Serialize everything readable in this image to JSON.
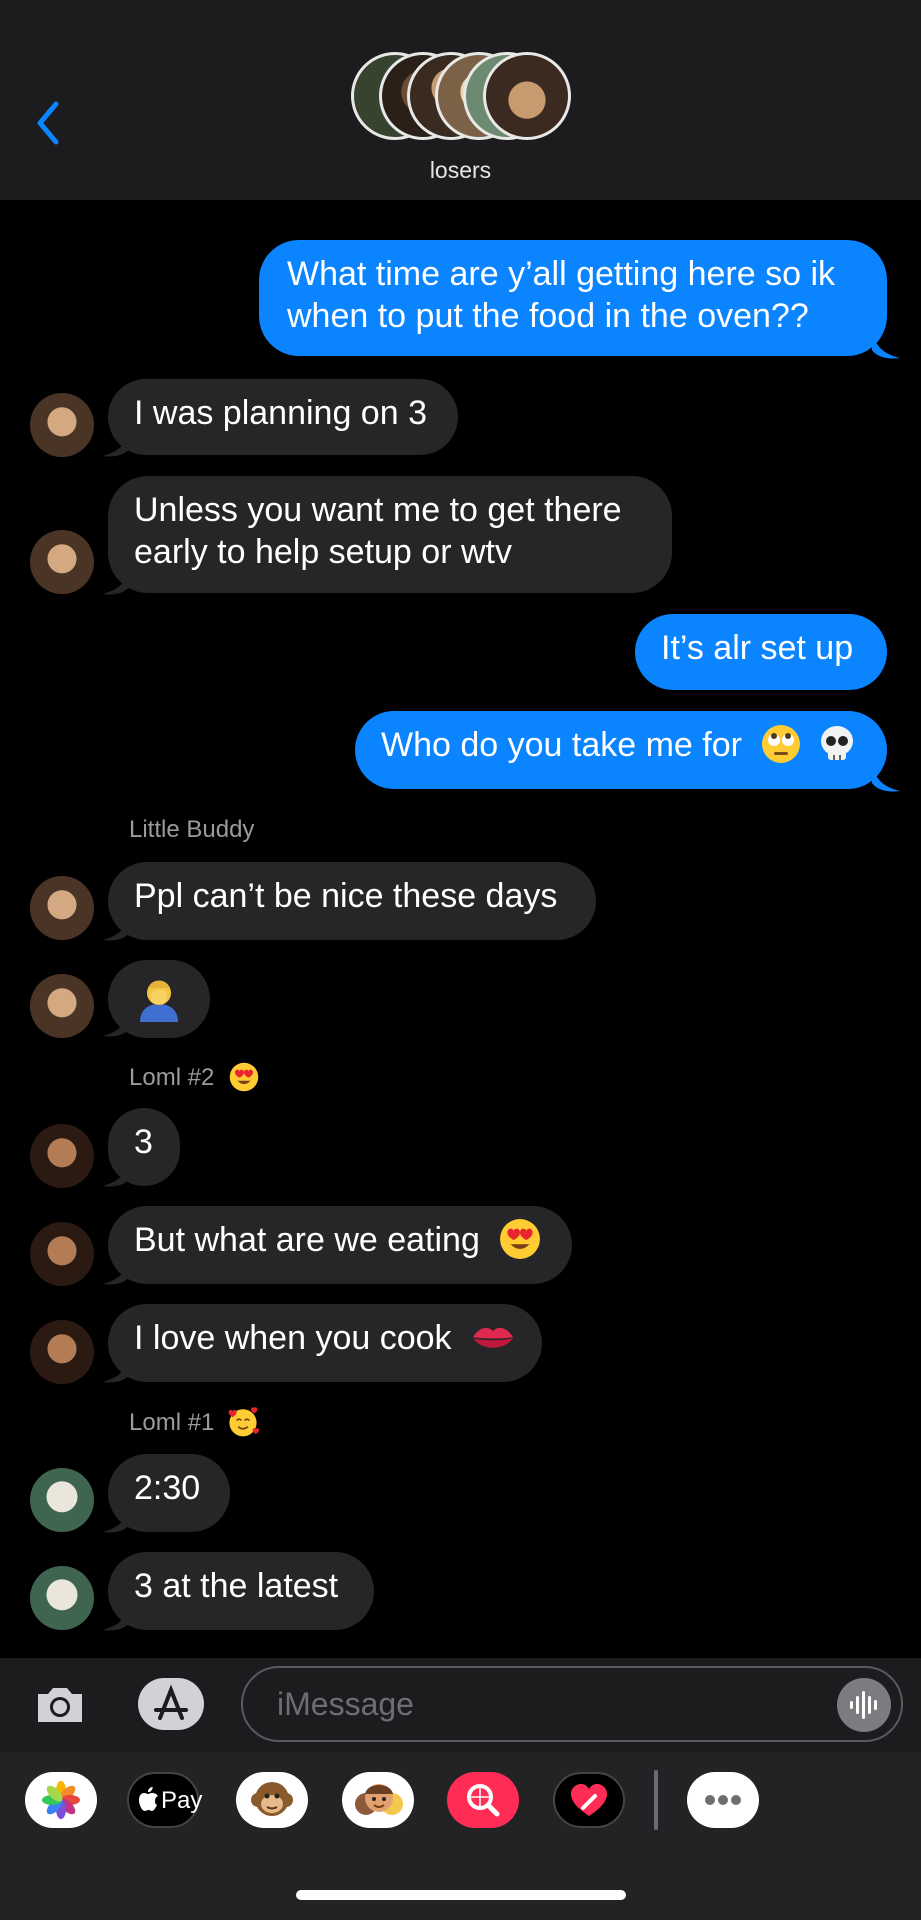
{
  "header": {
    "group_name": "losers"
  },
  "messages": [
    {
      "type": "sent",
      "text": "What time are y’all getting here so ik",
      "text2": "when to put the food in the oven??"
    },
    {
      "type": "recv",
      "text": "I was planning on 3"
    },
    {
      "type": "recv",
      "text": "Unless you want me to get there",
      "text2": "early to help setup or wtv"
    },
    {
      "type": "sent",
      "text": "It’s alr set up"
    },
    {
      "type": "sent",
      "text": "Who do you take me for"
    },
    {
      "type": "label",
      "text": "Little Buddy"
    },
    {
      "type": "recv",
      "text": "Ppl can’t be nice these days"
    },
    {
      "type": "recv",
      "emoji": "facepalm-emoji"
    },
    {
      "type": "label",
      "text": "Loml #2"
    },
    {
      "type": "recv",
      "text": "3"
    },
    {
      "type": "recv",
      "text": "But what are we eating"
    },
    {
      "type": "recv",
      "text": "I love when you cook"
    },
    {
      "type": "label",
      "text": "Loml #1"
    },
    {
      "type": "recv",
      "text": "2:30"
    },
    {
      "type": "recv",
      "text": "3 at the latest"
    }
  ],
  "input": {
    "placeholder": "iMessage"
  },
  "tray": {
    "pay_label": "Pay",
    "apps": [
      "photos-icon",
      "apple-pay-icon",
      "monkey-memoji-icon",
      "memoji-stickers-icon",
      "image-search-icon",
      "digital-touch-icon",
      "more-apps-icon"
    ]
  },
  "colors": {
    "sent_bubble": "#0a84ff",
    "recv_bubble": "#262628",
    "accent": "#0a84ff"
  }
}
